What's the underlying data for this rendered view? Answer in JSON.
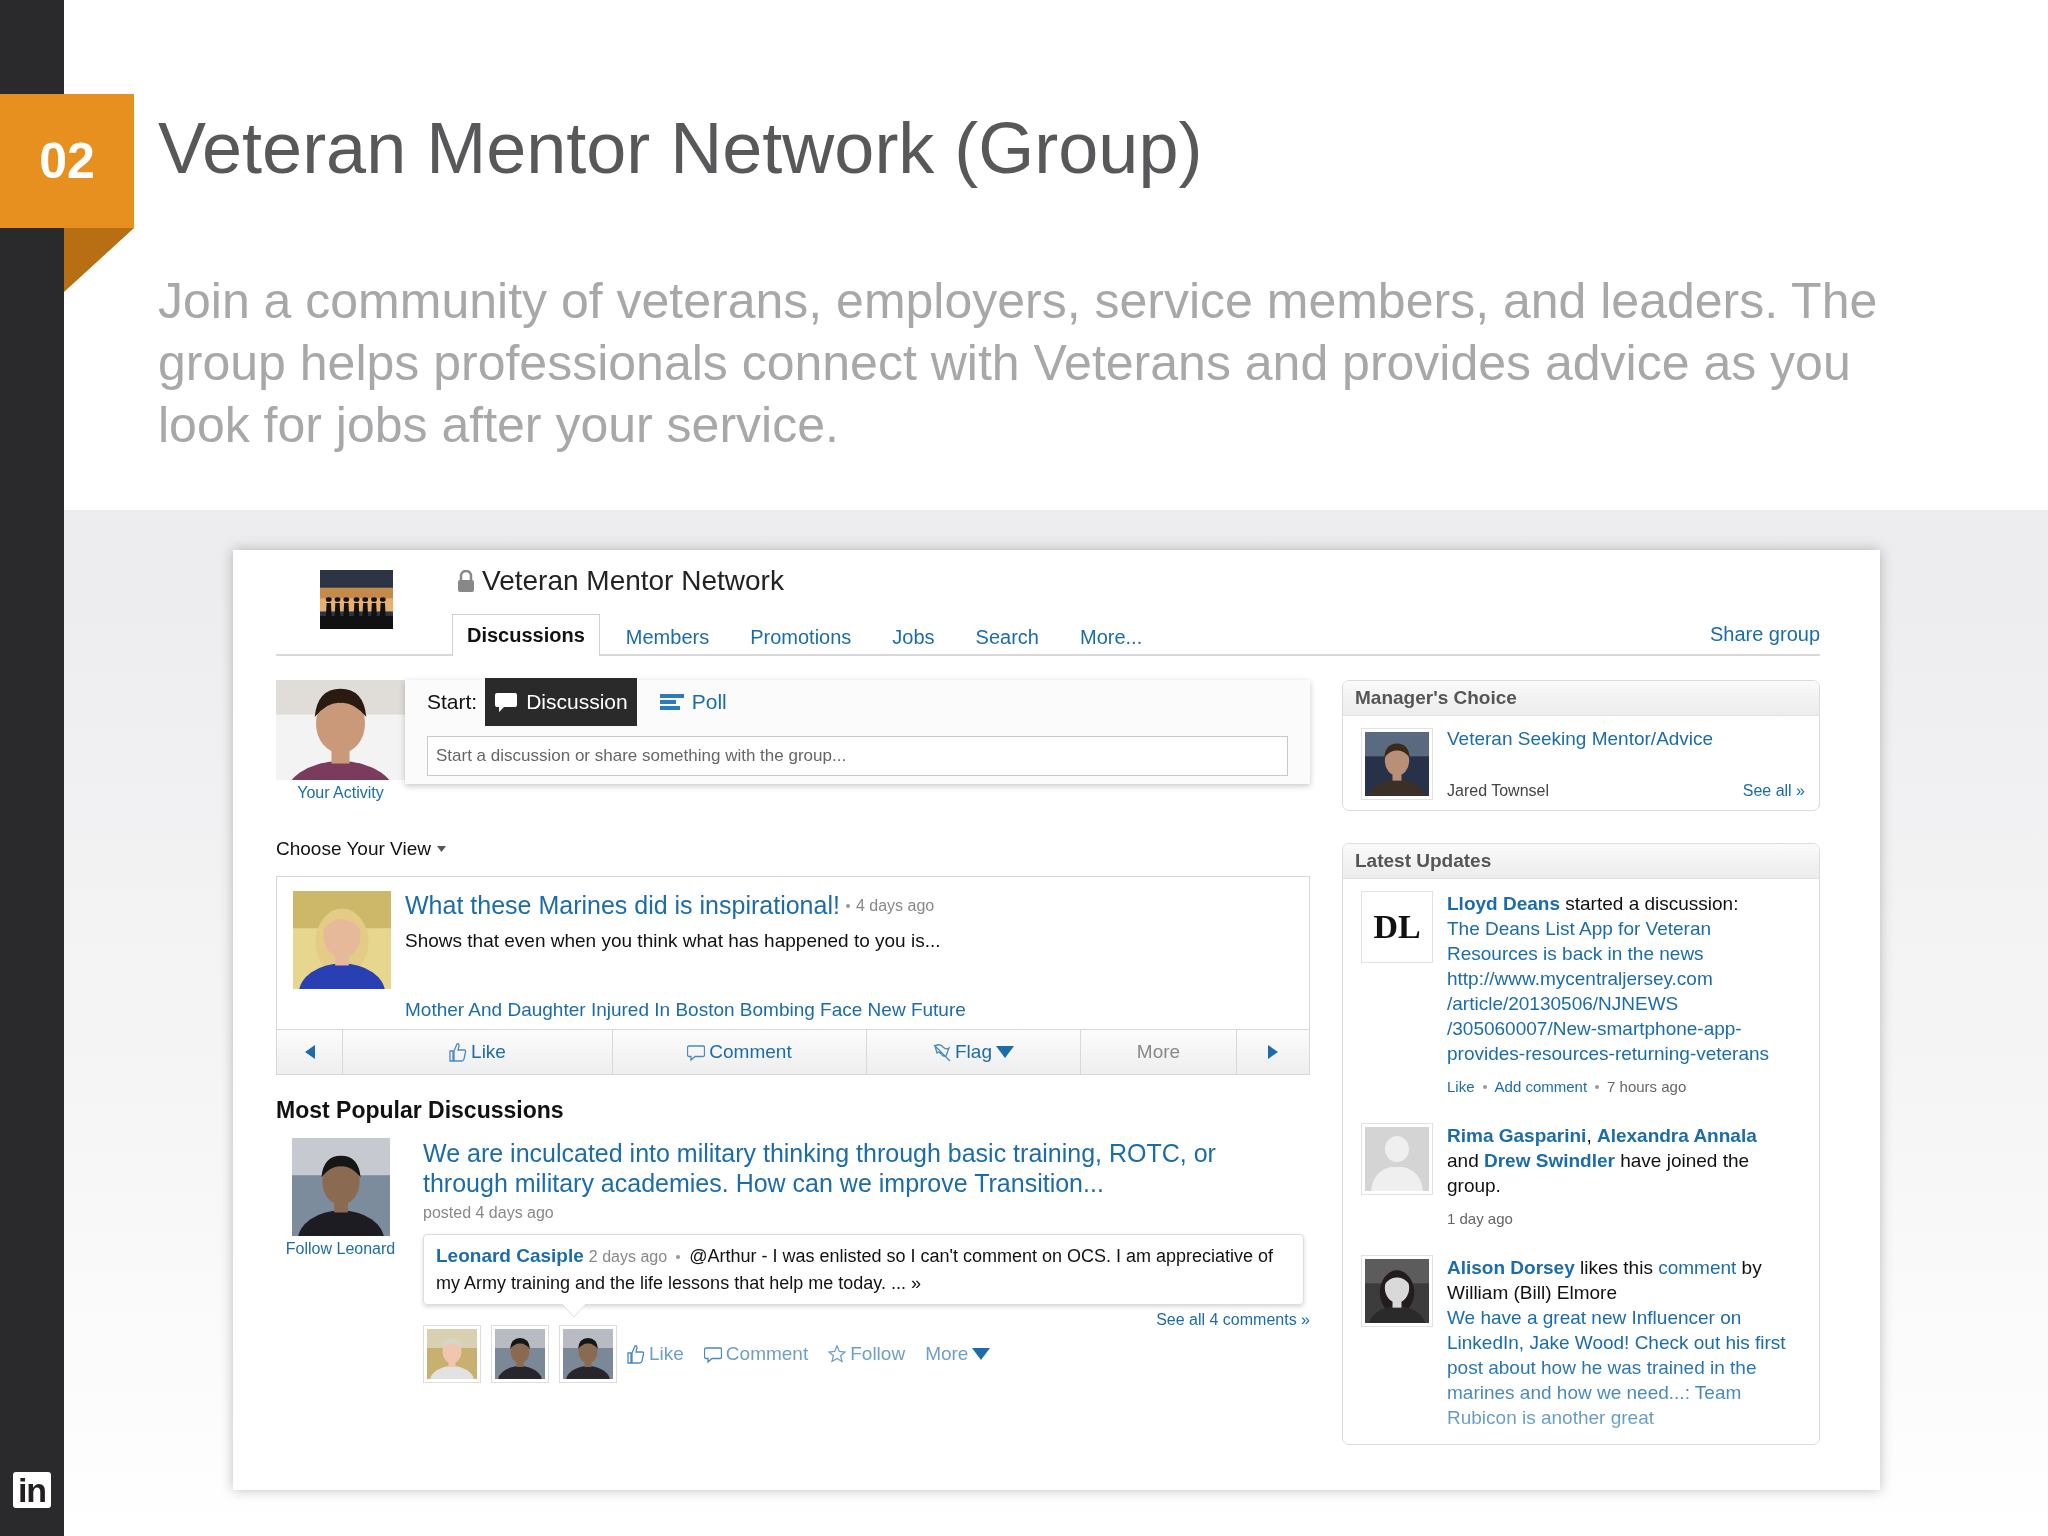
{
  "slide": {
    "number": "02",
    "title": "Veteran Mentor Network (Group)",
    "subtitle": "Join a community of veterans, employers, service members, and leaders. The group helps professionals connect with Veterans and provides advice as you look for jobs after your service.",
    "brand_logo": "in"
  },
  "group": {
    "name": "Veteran Mentor Network",
    "tabs": [
      {
        "label": "Discussions",
        "selected": true
      },
      {
        "label": "Members",
        "selected": false
      },
      {
        "label": "Promotions",
        "selected": false
      },
      {
        "label": "Jobs",
        "selected": false
      },
      {
        "label": "Search",
        "selected": false
      },
      {
        "label": "More...",
        "selected": false
      }
    ],
    "share": "Share group"
  },
  "composer": {
    "avatar_caption": "Your Activity",
    "start_label": "Start:",
    "options": [
      {
        "label": "Discussion",
        "kind": "discussion",
        "selected": true
      },
      {
        "label": "Poll",
        "kind": "poll",
        "selected": false
      }
    ],
    "placeholder": "Start a discussion or share something with the group..."
  },
  "view_menu": "Choose Your View",
  "featured": {
    "title": "What these Marines did is inspirational!",
    "time": "4 days ago",
    "excerpt": "Shows that even when you think what has happened to you is...",
    "link": "Mother And Daughter Injured In Boston Bombing Face New Future",
    "actions": [
      {
        "kind": "prev"
      },
      {
        "kind": "like",
        "label": "Like",
        "disabled": false,
        "menu": false
      },
      {
        "kind": "comment",
        "label": "Comment",
        "disabled": false,
        "menu": false
      },
      {
        "kind": "flag",
        "label": "Flag",
        "disabled": false,
        "menu": true
      },
      {
        "kind": "more",
        "label": "More",
        "disabled": true,
        "menu": false
      },
      {
        "kind": "next"
      }
    ]
  },
  "popular": {
    "heading": "Most Popular Discussions",
    "title": "We are inculcated into military thinking through basic training, ROTC, or through military academies. How can we improve Transition...",
    "posted": "posted 4 days ago",
    "follow": "Follow Leonard",
    "comment": {
      "author": "Leonard Casiple",
      "time": "2 days ago",
      "text": "@Arthur - I was enlisted so I can't comment on OCS. I am appreciative of my Army training and the life lessons that help me today. ... »"
    },
    "see_all": "See all 4 comments »",
    "actions": [
      {
        "kind": "like",
        "label": "Like",
        "disabled": false,
        "menu": false
      },
      {
        "kind": "comment",
        "label": "Comment",
        "disabled": false,
        "menu": false
      },
      {
        "kind": "follow",
        "label": "Follow",
        "disabled": false,
        "menu": false
      },
      {
        "kind": "more",
        "label": "More",
        "disabled": false,
        "menu": true
      }
    ]
  },
  "managers_choice": {
    "heading": "Manager's Choice",
    "title": "Veteran Seeking Mentor/Advice",
    "author": "Jared Townsel",
    "see_all": "See all »"
  },
  "latest_updates": {
    "heading": "Latest Updates",
    "items": [
      {
        "kind": "logo",
        "logo_text": "DL",
        "segments": [
          {
            "kind": "name",
            "text": "Lloyd Deans"
          },
          {
            "kind": "plain",
            "text": " started a discussion:"
          }
        ],
        "link": "The Deans List App for Veteran Resources is back in the news http://www.mycentraljersey.com /article/20130506/NJNEWS /305060007/New-smartphone-app-provides-resources-returning-veterans",
        "actions": [
          "Like",
          "Add comment"
        ],
        "time": "7 hours ago"
      },
      {
        "kind": "placeholder",
        "segments": [
          {
            "kind": "name",
            "text": "Rima Gasparini"
          },
          {
            "kind": "plain",
            "text": ", "
          },
          {
            "kind": "name",
            "text": "Alexandra Annala"
          },
          {
            "kind": "plain",
            "text": " and "
          },
          {
            "kind": "name",
            "text": "Drew Swindler"
          },
          {
            "kind": "plain",
            "text": " have joined the group."
          }
        ],
        "time": "1 day ago"
      },
      {
        "segments": [
          {
            "kind": "name",
            "text": "Alison Dorsey"
          },
          {
            "kind": "plain",
            "text": " likes this "
          },
          {
            "kind": "link",
            "text": "comment"
          },
          {
            "kind": "plain",
            "text": " by William (Bill) Elmore"
          }
        ],
        "quote": "We have a great new Influencer on LinkedIn, Jake Wood! Check out his first post about how he was trained in the marines and how we need...: Team Rubicon is another great"
      }
    ]
  }
}
